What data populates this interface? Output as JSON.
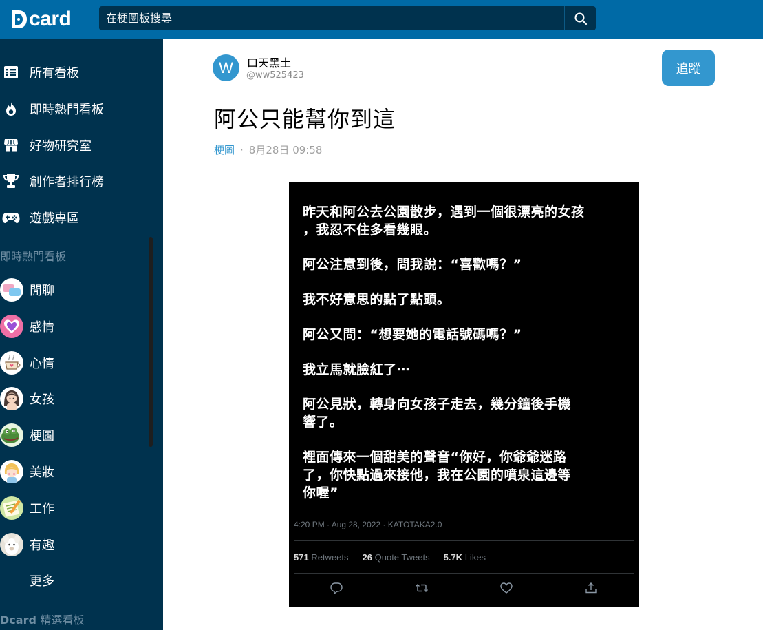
{
  "header": {
    "logo_text": "card",
    "search_placeholder": "在梗圖板搜尋"
  },
  "sidebar": {
    "nav": [
      {
        "label": "所有看板",
        "icon": "list-icon"
      },
      {
        "label": "即時熱門看板",
        "icon": "fire-icon"
      },
      {
        "label": "好物研究室",
        "icon": "store-icon"
      },
      {
        "label": "創作者排行榜",
        "icon": "trophy-icon"
      },
      {
        "label": "遊戲專區",
        "icon": "gamepad-icon"
      }
    ],
    "section_hot": "即時熱門看板",
    "boards": [
      {
        "label": "閒聊"
      },
      {
        "label": "感情"
      },
      {
        "label": "心情"
      },
      {
        "label": "女孩"
      },
      {
        "label": "梗圖"
      },
      {
        "label": "美妝"
      },
      {
        "label": "工作"
      },
      {
        "label": "有趣"
      }
    ],
    "more": "更多",
    "section_featured_brand": "Dcard",
    "section_featured": "精選看板"
  },
  "post": {
    "author_initial": "W",
    "author_name": "口天黑土",
    "author_handle": "@ww525423",
    "follow_label": "追蹤",
    "title": "阿公只能幫你到這",
    "board": "梗圖",
    "dot": "·",
    "date": "8月28日 09:58"
  },
  "tweet": {
    "paragraphs": [
      [
        "昨天和阿公去公園散步，遇到一個很漂亮的女孩",
        "，我忍不住多看幾眼。"
      ],
      [
        "阿公注意到後，問我說：“喜歡嗎？”"
      ],
      [
        "我不好意思的點了點頭。"
      ],
      [
        "阿公又問：“想要她的電話號碼嗎？”"
      ],
      [
        "我立馬就臉紅了⋯"
      ],
      [
        "阿公見狀，轉身向女孩子走去，幾分鐘後手機",
        "響了。"
      ],
      [
        "裡面傳來一個甜美的聲音“你好，你爺爺迷路",
        "了，你快點過來接他，我在公園的噴泉這邊等",
        "你喔”"
      ]
    ],
    "timestamp": "4:20 PM · Aug 28, 2022 · KATOTAKA2.0",
    "retweets_count": "571",
    "retweets_label": "Retweets",
    "quotes_count": "26",
    "quotes_label": "Quote Tweets",
    "likes_count": "5.7K",
    "likes_label": "Likes"
  },
  "colors": {
    "header_bg": "#006aa6",
    "sidebar_bg": "#00324e",
    "accent": "#3397cf"
  }
}
